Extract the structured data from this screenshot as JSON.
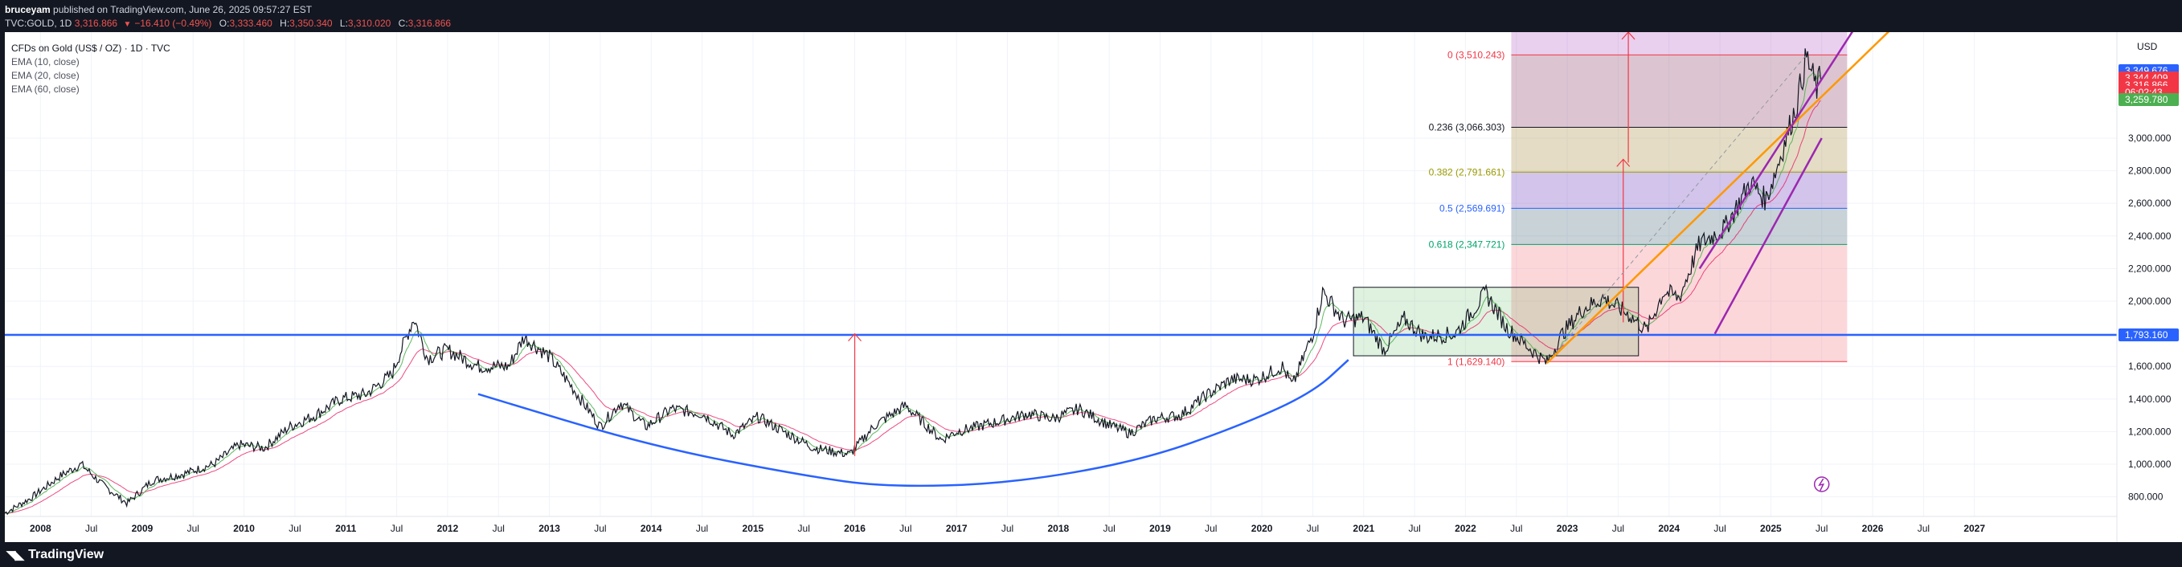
{
  "header": {
    "author": "bruceyam",
    "published": "published on TradingView.com, June 26, 2025 09:57:27 EST",
    "symbol": "TVC:GOLD, 1D",
    "last": "3,316.866",
    "change": "−16.410 (−0.49%)",
    "o_label": "O:",
    "o": "3,333.460",
    "h_label": "H:",
    "h": "3,350.340",
    "l_label": "L:",
    "l": "3,310.020",
    "c_label": "C:",
    "c": "3,316.866"
  },
  "legend": {
    "title": "CFDs on Gold (US$ / OZ) · 1D · TVC",
    "ema10": "EMA (10, close)",
    "ema20": "EMA (20, close)",
    "ema60": "EMA (60, close)"
  },
  "footer": {
    "brand": "TradingView",
    "logo_icon": "tradingview-logo-icon"
  },
  "colors": {
    "candles": "#131722",
    "ema_green": "#4caf50",
    "ema_red": "#e91e63",
    "horizontal_line": "#2962ff",
    "arc": "#2962ff",
    "orange": "#ff9800",
    "purple": "#9c27b0",
    "arrow": "#f23645"
  },
  "chart_data": {
    "type": "line",
    "currency": "USD",
    "x_ticks": [
      "2008",
      "Jul",
      "2009",
      "Jul",
      "2010",
      "Jul",
      "2011",
      "Jul",
      "2012",
      "Jul",
      "2013",
      "Jul",
      "2014",
      "Jul",
      "2015",
      "Jul",
      "2016",
      "Jul",
      "2017",
      "Jul",
      "2018",
      "Jul",
      "2019",
      "Jul",
      "2020",
      "Jul",
      "2021",
      "Jul",
      "2022",
      "Jul",
      "2023",
      "Jul",
      "2024",
      "Jul",
      "2025",
      "Jul",
      "2026",
      "Jul",
      "2027"
    ],
    "x_tick_years": [
      2008.0,
      2008.5,
      2009.0,
      2009.5,
      2010.0,
      2010.5,
      2011.0,
      2011.5,
      2012.0,
      2012.5,
      2013.0,
      2013.5,
      2014.0,
      2014.5,
      2015.0,
      2015.5,
      2016.0,
      2016.5,
      2017.0,
      2017.5,
      2018.0,
      2018.5,
      2019.0,
      2019.5,
      2020.0,
      2020.5,
      2021.0,
      2021.5,
      2022.0,
      2022.5,
      2023.0,
      2023.5,
      2024.0,
      2024.5,
      2025.0,
      2025.5,
      2026.0,
      2026.5,
      2027.0
    ],
    "y_ticks": [
      "3,000.000",
      "2,800.000",
      "2,600.000",
      "2,400.000",
      "2,200.000",
      "2,000.000",
      "1,800.000",
      "1,600.000",
      "1,400.000",
      "1,200.000",
      "1,000.000",
      "800.000"
    ],
    "y_tick_values": [
      3000,
      2800,
      2600,
      2400,
      2200,
      2000,
      1800,
      1600,
      1400,
      1200,
      1000,
      800
    ],
    "ylim": [
      680,
      3650
    ],
    "xlim": [
      2007.65,
      2028.4
    ],
    "price_series": {
      "name": "GOLD",
      "points": [
        [
          2007.65,
          700
        ],
        [
          2007.9,
          790
        ],
        [
          2008.2,
          930
        ],
        [
          2008.4,
          1000
        ],
        [
          2008.6,
          880
        ],
        [
          2008.85,
          760
        ],
        [
          2009.1,
          900
        ],
        [
          2009.4,
          940
        ],
        [
          2009.7,
          1000
        ],
        [
          2009.95,
          1120
        ],
        [
          2010.2,
          1100
        ],
        [
          2010.45,
          1230
        ],
        [
          2010.7,
          1300
        ],
        [
          2010.95,
          1400
        ],
        [
          2011.2,
          1430
        ],
        [
          2011.45,
          1550
        ],
        [
          2011.67,
          1900
        ],
        [
          2011.8,
          1650
        ],
        [
          2012.0,
          1700
        ],
        [
          2012.3,
          1600
        ],
        [
          2012.6,
          1600
        ],
        [
          2012.75,
          1780
        ],
        [
          2013.0,
          1660
        ],
        [
          2013.25,
          1450
        ],
        [
          2013.5,
          1230
        ],
        [
          2013.7,
          1380
        ],
        [
          2013.95,
          1230
        ],
        [
          2014.2,
          1340
        ],
        [
          2014.5,
          1310
        ],
        [
          2014.8,
          1180
        ],
        [
          2015.05,
          1290
        ],
        [
          2015.3,
          1200
        ],
        [
          2015.6,
          1100
        ],
        [
          2015.95,
          1060
        ],
        [
          2016.2,
          1240
        ],
        [
          2016.5,
          1360
        ],
        [
          2016.85,
          1150
        ],
        [
          2017.0,
          1200
        ],
        [
          2017.4,
          1260
        ],
        [
          2017.7,
          1310
        ],
        [
          2017.95,
          1280
        ],
        [
          2018.2,
          1340
        ],
        [
          2018.5,
          1240
        ],
        [
          2018.7,
          1190
        ],
        [
          2018.95,
          1280
        ],
        [
          2019.2,
          1300
        ],
        [
          2019.45,
          1420
        ],
        [
          2019.7,
          1520
        ],
        [
          2019.95,
          1520
        ],
        [
          2020.2,
          1600
        ],
        [
          2020.3,
          1480
        ],
        [
          2020.5,
          1800
        ],
        [
          2020.6,
          2060
        ],
        [
          2020.8,
          1880
        ],
        [
          2021.0,
          1900
        ],
        [
          2021.2,
          1700
        ],
        [
          2021.4,
          1890
        ],
        [
          2021.6,
          1780
        ],
        [
          2021.9,
          1800
        ],
        [
          2022.2,
          2050
        ],
        [
          2022.4,
          1840
        ],
        [
          2022.65,
          1700
        ],
        [
          2022.8,
          1620
        ],
        [
          2022.95,
          1800
        ],
        [
          2023.15,
          1950
        ],
        [
          2023.35,
          2020
        ],
        [
          2023.6,
          1920
        ],
        [
          2023.78,
          1820
        ],
        [
          2023.95,
          2060
        ],
        [
          2024.1,
          2020
        ],
        [
          2024.3,
          2350
        ],
        [
          2024.55,
          2450
        ],
        [
          2024.8,
          2730
        ],
        [
          2024.95,
          2620
        ],
        [
          2025.05,
          2800
        ],
        [
          2025.25,
          3200
        ],
        [
          2025.35,
          3500
        ],
        [
          2025.45,
          3300
        ],
        [
          2025.5,
          3400
        ],
        [
          2025.49,
          3316.866
        ]
      ]
    },
    "horizontal_level": {
      "value": 1793.16,
      "label": "1,793.160"
    },
    "fibonacci": {
      "x_range": [
        2022.45,
        2025.75
      ],
      "levels": [
        {
          "ratio": "0",
          "value": 3510.243,
          "label": "0 (3,510.243)",
          "color": "#f23645"
        },
        {
          "ratio": "0.236",
          "value": 3066.303,
          "label": "0.236 (3,066.303)",
          "color": "#131722"
        },
        {
          "ratio": "0.382",
          "value": 2791.661,
          "label": "0.382 (2,791.661)",
          "color": "#9a9a00"
        },
        {
          "ratio": "0.5",
          "value": 2569.691,
          "label": "0.5 (2,569.691)",
          "color": "#2962ff"
        },
        {
          "ratio": "0.618",
          "value": 2347.721,
          "label": "0.618 (2,347.721)",
          "color": "#00a36c"
        },
        {
          "ratio": "1",
          "value": 1629.14,
          "label": "1 (1,629.140)",
          "color": "#f23645"
        }
      ]
    },
    "price_labels": [
      {
        "value": 3349.676,
        "label": "3,349.676",
        "color": "#2962ff"
      },
      {
        "value": 3344.409,
        "label": "3,344.409",
        "color": "#f23645"
      },
      {
        "value": 3316.866,
        "label": "3,316.866",
        "color": "#f23645"
      },
      {
        "value": 3293,
        "label": "06:02:43",
        "color": "#f23645"
      },
      {
        "value": 3259.78,
        "label": "3,259.780",
        "color": "#4caf50"
      },
      {
        "value": 1793.16,
        "label": "1,793.160",
        "color": "#2962ff"
      }
    ],
    "consolidation_box": {
      "x": [
        2020.9,
        2023.7
      ],
      "y": [
        1665,
        2085
      ]
    },
    "arc": {
      "points": [
        [
          2012.3,
          1430
        ],
        [
          2014.0,
          1110
        ],
        [
          2015.5,
          930
        ],
        [
          2016.3,
          860
        ],
        [
          2017.5,
          880
        ],
        [
          2018.8,
          1020
        ],
        [
          2019.8,
          1240
        ],
        [
          2020.5,
          1440
        ],
        [
          2020.85,
          1640
        ]
      ]
    },
    "arrows": [
      {
        "x": 2016.0,
        "from": 1050,
        "to": 1800
      },
      {
        "x": 2023.55,
        "from": 1870,
        "to": 2870
      },
      {
        "x": 2023.6,
        "from": 2850,
        "to": 3650
      }
    ],
    "trend_lines": [
      {
        "color": "#ff9800",
        "from": [
          2022.8,
          1620
        ],
        "to": [
          2026.4,
          3800
        ]
      },
      {
        "color": "#9c27b0",
        "from": [
          2024.3,
          2200
        ],
        "to": [
          2025.85,
          3700
        ]
      },
      {
        "color": "#9c27b0",
        "from": [
          2024.45,
          1800
        ],
        "to": [
          2025.5,
          3000
        ]
      }
    ]
  }
}
